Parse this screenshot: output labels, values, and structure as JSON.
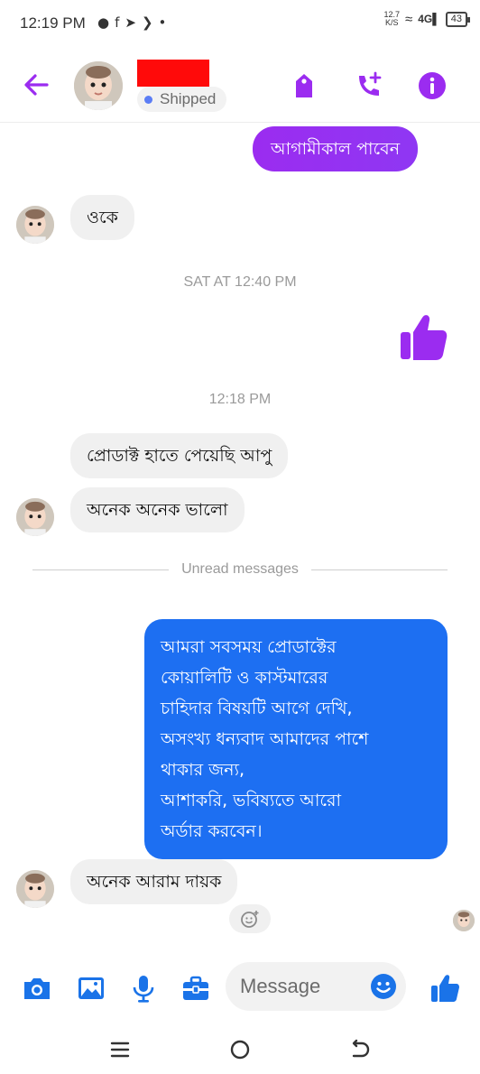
{
  "status_bar": {
    "time": "12:19 PM",
    "notification_icons": [
      "chat-bubble-icon",
      "facebook-icon",
      "send-icon",
      "arrow-icon",
      "dot-icon"
    ],
    "net_speed_value": "12.7",
    "net_speed_unit": "K/S",
    "signal_label": "4G",
    "battery": "43"
  },
  "header": {
    "status_text": "Shipped",
    "accent_color": "#9b2cf0",
    "actions": [
      "tag-icon",
      "call-add-icon",
      "info-icon"
    ]
  },
  "messages": [
    {
      "id": "m1",
      "side": "out",
      "text": "আগামীকাল পাবেন"
    },
    {
      "id": "m2",
      "side": "in",
      "text": "ওকে"
    },
    {
      "id": "m3",
      "side": "out",
      "type": "like"
    },
    {
      "id": "m4",
      "side": "in",
      "text": "প্রোডাক্ট হাতে পেয়েছি আপু"
    },
    {
      "id": "m5",
      "side": "in",
      "text": "অনেক অনেক ভালো"
    },
    {
      "id": "m6",
      "side": "out",
      "lines": [
        "আমরা সবসময় প্রোডাক্টের",
        "কোয়ালিটি ও কাস্টমারের",
        "চাহিদার বিষয়টি আগে দেখি,",
        "অসংখ্য ধন্যবাদ আমাদের পাশে",
        "থাকার জন্য,",
        "আশাকরি,  ভবিষ্যতে আরো",
        "অর্ডার করবেন।"
      ]
    },
    {
      "id": "m7",
      "side": "in",
      "text": "অনেক আরাম দায়ক"
    }
  ],
  "timestamps": {
    "t1": "SAT AT 12:40 PM",
    "t2": "12:18 PM"
  },
  "unread_label": "Unread messages",
  "composer": {
    "placeholder": "Message",
    "buttons": [
      "camera-icon",
      "gallery-icon",
      "microphone-icon",
      "toolbox-icon",
      "emoji-icon",
      "like-icon"
    ]
  },
  "nav": [
    "menu-icon",
    "home-icon",
    "back-icon"
  ]
}
